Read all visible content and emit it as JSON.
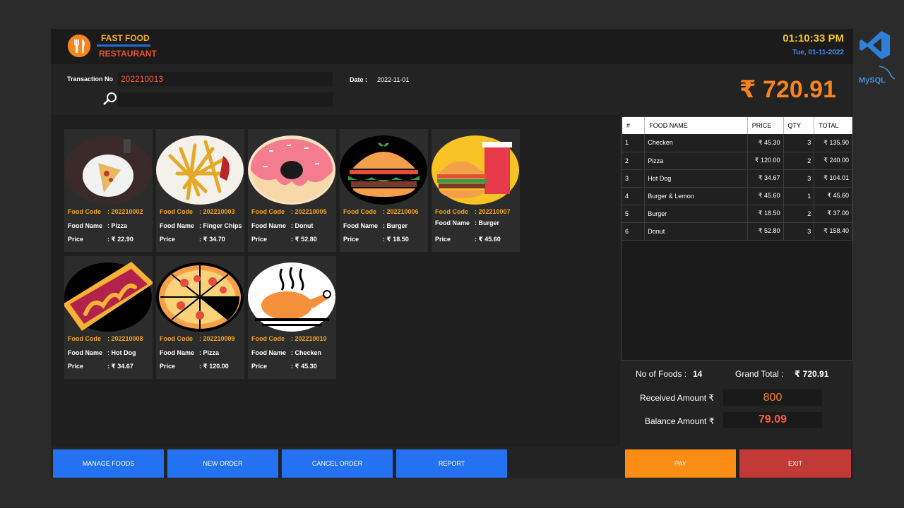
{
  "header": {
    "brand_line1": "FAST FOOD",
    "brand_line2": "RESTAURANT",
    "time": "01:10:33 PM",
    "date": "Tue, 01-11-2022",
    "logo_icon": "fork-knife-icon"
  },
  "transaction": {
    "label": "Transaction No",
    "value": "202210013",
    "search_placeholder": "",
    "date_label": "Date :",
    "date_value": "2022-11-01"
  },
  "grand_total_display": "₹ 720.91",
  "food_cards": [
    {
      "code_label": "Food Code",
      "code": ": 202210002",
      "name_label": "Food Name",
      "name": ": Pizza",
      "price_label": "Price",
      "price": ": ₹ 22.90",
      "image": "pizza-slice-photo"
    },
    {
      "code_label": "Food Code",
      "code": ": 202210003",
      "name_label": "Food Name",
      "name": ": Finger Chips",
      "price_label": "Price",
      "price": ": ₹ 34.70",
      "image": "fries-photo"
    },
    {
      "code_label": "Food Code",
      "code": ": 202210005",
      "name_label": "Food Name",
      "name": ": Donut",
      "price_label": "Price",
      "price": ": ₹ 52.80",
      "image": "donut-icon"
    },
    {
      "code_label": "Food Code",
      "code": ": 202210006",
      "name_label": "Food Name",
      "name": ": Burger",
      "price_label": "Price",
      "price": ": ₹ 18.50",
      "image": "burger-icon"
    },
    {
      "code_label": "Food Code",
      "code": ": 202210007",
      "name_label": "Food Name",
      "name": ": Burger",
      "price_label": "Price",
      "price": ": ₹ 45.60",
      "image": "burger-drink-icon"
    },
    {
      "code_label": "Food Code",
      "code": ": 202210008",
      "name_label": "Food Name",
      "name": ": Hot Dog",
      "price_label": "Price",
      "price": ": ₹ 34.67",
      "image": "hotdog-icon"
    },
    {
      "code_label": "Food Code",
      "code": ": 202210009",
      "name_label": "Food Name",
      "name": ": Pizza",
      "price_label": "Price",
      "price": ": ₹ 120.00",
      "image": "pizza-icon"
    },
    {
      "code_label": "Food Code",
      "code": ": 202210010",
      "name_label": "Food Name",
      "name": ": Checken",
      "price_label": "Price",
      "price": ": ₹ 45.30",
      "image": "roast-chicken-icon"
    }
  ],
  "order_table": {
    "headers": [
      "#",
      "FOOD NAME",
      "PRICE",
      "QTY",
      "TOTAL"
    ],
    "rows": [
      [
        "1",
        "Checken",
        "₹ 45.30",
        "3",
        "₹ 135.90"
      ],
      [
        "2",
        "Pizza",
        "₹ 120.00",
        "2",
        "₹ 240.00"
      ],
      [
        "3",
        "Hot Dog",
        "₹ 34.67",
        "3",
        "₹ 104.01"
      ],
      [
        "4",
        "Burger & Lemon",
        "₹ 45.60",
        "1",
        "₹ 45.60"
      ],
      [
        "5",
        "Burger",
        "₹ 18.50",
        "2",
        "₹ 37.00"
      ],
      [
        "6",
        "Donut",
        "₹ 52.80",
        "3",
        "₹ 158.40"
      ]
    ]
  },
  "summary": {
    "no_of_foods_label": "No of Foods :",
    "no_of_foods": "14",
    "grand_total_label": "Grand Total :",
    "grand_total": "₹ 720.91",
    "received_label": "Received Amount ₹",
    "received_value": "800",
    "balance_label": "Balance Amount ₹",
    "balance_value": "79.09"
  },
  "buttons": {
    "manage_foods": "MANAGE FOODS",
    "new_order": "NEW ORDER",
    "cancel_order": "CANCEL ORDER",
    "report": "REPORT",
    "pay": "PAY",
    "exit": "EXIT"
  },
  "side_logos": {
    "vs": "visual-studio-icon",
    "mysql_text": "MySQL"
  },
  "colors": {
    "accent_orange": "#f7841d",
    "accent_red": "#ff5a36",
    "button_blue": "#2472f2",
    "button_orange": "#fb8c14",
    "button_red": "#c23a38",
    "code_yellow": "#f3a51c"
  }
}
